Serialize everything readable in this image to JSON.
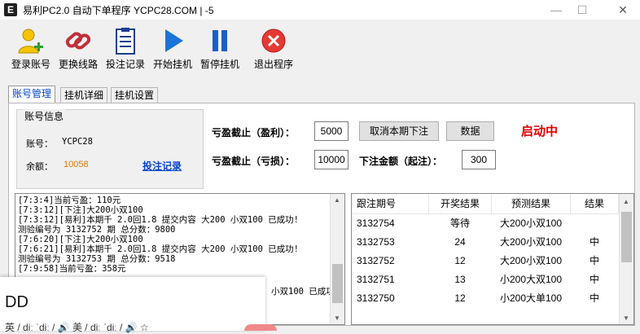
{
  "window": {
    "title": "易利PC2.0 自动下单程序 YCPC28.COM  |  -5",
    "app_icon": "E",
    "min_glyph": "—",
    "max_glyph": "☐",
    "close_glyph": "✕"
  },
  "toolbar": {
    "items": [
      {
        "label": "登录账号",
        "icon": "user-add-icon"
      },
      {
        "label": "更换线路",
        "icon": "link-icon"
      },
      {
        "label": "投注记录",
        "icon": "clipboard-icon"
      },
      {
        "label": "开始挂机",
        "icon": "play-icon"
      },
      {
        "label": "暂停挂机",
        "icon": "pause-icon"
      },
      {
        "label": "退出程序",
        "icon": "close-circle-icon"
      }
    ]
  },
  "tabs": [
    "账号管理",
    "挂机详细",
    "挂机设置"
  ],
  "account": {
    "group_title": "账号信息",
    "account_label": "账号：",
    "account_value": "YCPC28",
    "balance_label": "余额：",
    "balance_value": "10058",
    "bet_record_link": "投注记录"
  },
  "settings": {
    "profit_stop_label": "亏盈截止（盈利）：",
    "profit_stop_value": "5000",
    "loss_stop_label": "亏盈截止（亏损）：",
    "loss_stop_value": "10000",
    "bet_amount_label": "下注金额（起注）：",
    "bet_amount_value": "300",
    "cancel_button": "取消本期下注",
    "data_button": "数据",
    "status_text": "启动中"
  },
  "log": {
    "lines": [
      "[7:3:4]当前亏盈：110元",
      "[7:3:12][下注]大200小双100",
      "[7:3:12][易利]本期千 2.0回1.8 提交内容 大200 小双100 已成功!",
      "测验编号为 3132752 期 总分数：9800",
      "[7:6:20][下注]大200小双100",
      "[7:6:21][易利]本期千 2.0回1.8 提交内容 大200 小双100 已成功!",
      "测验编号为 3132753 期 总分数：9518",
      "[7:9:58]当前亏盈：358元"
    ],
    "partial_line": "小双100 已成功!"
  },
  "results_table": {
    "headers": [
      "跟注期号",
      "开奖结果",
      "预测结果",
      "结果"
    ],
    "rows": [
      [
        "3132754",
        "等待",
        "大200小双100",
        ""
      ],
      [
        "3132753",
        "24",
        "大200小双100",
        "中"
      ],
      [
        "3132752",
        "12",
        "大200小双100",
        "中"
      ],
      [
        "3132751",
        "13",
        "小200大双100",
        "中"
      ],
      [
        "3132750",
        "12",
        "小200大单100",
        "中"
      ]
    ]
  },
  "dict_popup": {
    "word": "DD",
    "phonetic": "英 / diː ˈdiː / 🔊    美 / diː ˈdiː / 🔊    ☆"
  },
  "colors": {
    "status_red": "#e00000",
    "link_blue": "#0645c8",
    "balance_orange": "#e07800",
    "play_blue": "#1a73d9",
    "exit_red": "#e53935"
  }
}
